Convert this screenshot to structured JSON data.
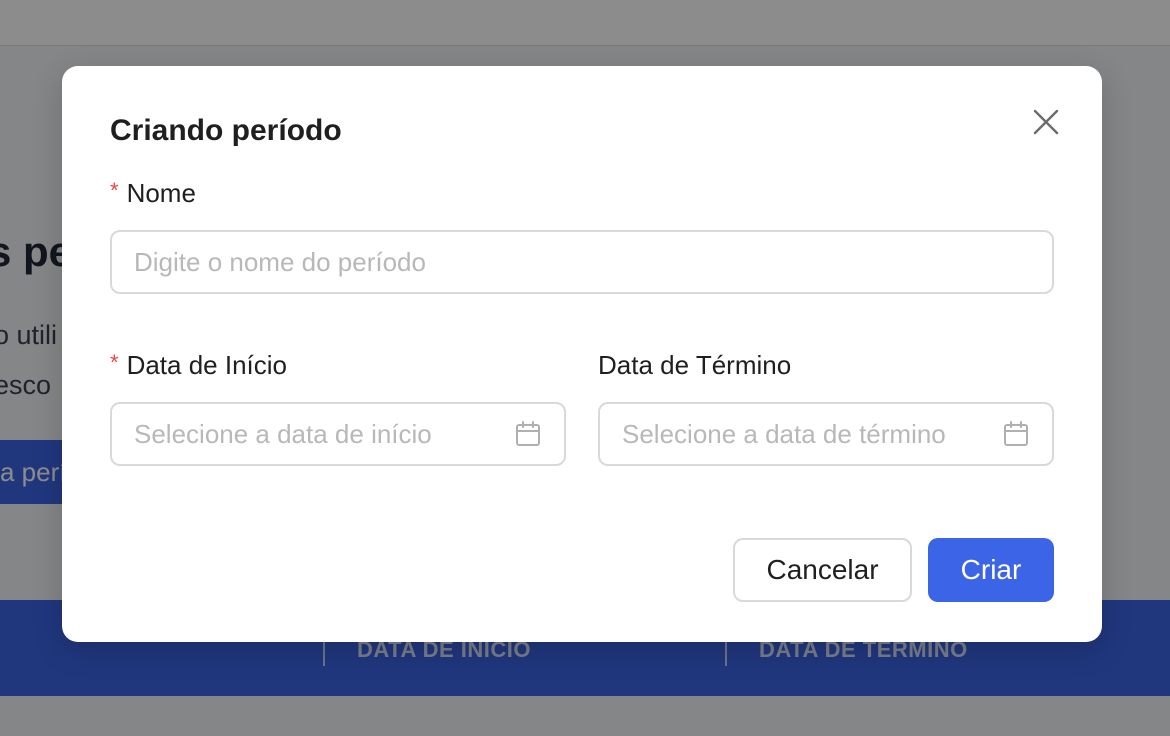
{
  "background": {
    "heading": "s pe",
    "description_line1": "o utili",
    "description_line2": "esco",
    "action_button": "a perí",
    "table_columns": [
      "DATA DE INÍCIO",
      "DATA DE TÉRMINO"
    ]
  },
  "modal": {
    "title": "Criando período",
    "close_icon": "close-icon",
    "fields": {
      "name": {
        "label": "Nome",
        "required_mark": "*",
        "placeholder": "Digite o nome do período",
        "value": ""
      },
      "start_date": {
        "label": "Data de Início",
        "required_mark": "*",
        "placeholder": "Selecione a data de início",
        "value": "",
        "icon": "calendar-icon"
      },
      "end_date": {
        "label": "Data de Término",
        "placeholder": "Selecione a data de término",
        "value": "",
        "icon": "calendar-icon"
      }
    },
    "buttons": {
      "cancel": "Cancelar",
      "create": "Criar"
    }
  },
  "colors": {
    "primary": "#3b65e6",
    "required": "#ef4444",
    "overlay": "rgba(0,0,0,0.45)"
  }
}
